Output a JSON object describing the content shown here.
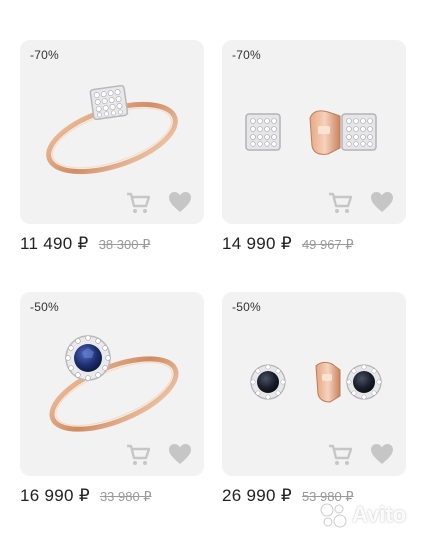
{
  "colors": {
    "card_bg": "#f2f2f2",
    "icon": "#c6c6c6",
    "old_price": "#9a9a9a",
    "gold": "#d9a27a",
    "sapphire": "#1d2e6e"
  },
  "products": [
    {
      "discount": "-70%",
      "price": "11 490 ₽",
      "old_price": "38 300 ₽",
      "image": "gold-ring-with-square-diamond-top",
      "cart_icon": "cart-icon",
      "favorite_icon": "heart-icon"
    },
    {
      "discount": "-70%",
      "price": "14 990 ₽",
      "old_price": "49 967 ₽",
      "image": "square-diamond-stud-earrings",
      "cart_icon": "cart-icon",
      "favorite_icon": "heart-icon"
    },
    {
      "discount": "-50%",
      "price": "16 990 ₽",
      "old_price": "33 980 ₽",
      "image": "gold-ring-with-sapphire-halo",
      "cart_icon": "cart-icon",
      "favorite_icon": "heart-icon"
    },
    {
      "discount": "-50%",
      "price": "26 990 ₽",
      "old_price": "53 980 ₽",
      "image": "round-dark-stone-stud-earrings",
      "cart_icon": "cart-icon",
      "favorite_icon": "heart-icon"
    }
  ],
  "watermark": {
    "text": "Avito",
    "icon": "avito-logo-icon"
  }
}
